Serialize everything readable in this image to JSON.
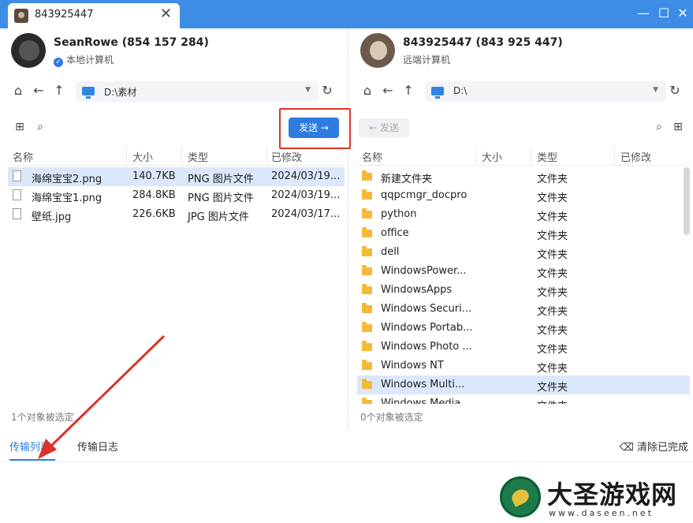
{
  "tab": {
    "title": "843925447",
    "close": "✕"
  },
  "window_controls": {
    "minimize": "—",
    "maximize": "☐",
    "close": "✕"
  },
  "local": {
    "user_name": "SeanRowe (854 157 284)",
    "user_sub": "本地计算机",
    "path": "D:\\素材",
    "send_label": "发送 →",
    "columns": [
      "名称",
      "大小",
      "类型",
      "已修改"
    ],
    "files": [
      {
        "name": "海绵宝宝2.png",
        "size": "140.7KB",
        "type": "PNG 图片文件",
        "modified": "2024/03/19...",
        "selected": true
      },
      {
        "name": "海绵宝宝1.png",
        "size": "284.8KB",
        "type": "PNG 图片文件",
        "modified": "2024/03/19...",
        "selected": false
      },
      {
        "name": "壁纸.jpg",
        "size": "226.6KB",
        "type": "JPG 图片文件",
        "modified": "2024/03/17...",
        "selected": false
      }
    ],
    "status": "1个对象被选定"
  },
  "remote": {
    "user_name": "843925447 (843 925 447)",
    "user_sub": "远端计算机",
    "path": "D:\\",
    "back_label": "← 发送",
    "columns": [
      "名称",
      "大小",
      "类型",
      "已修改"
    ],
    "files": [
      {
        "name": "新建文件夹",
        "type": "文件夹"
      },
      {
        "name": "qqpcmgr_docpro",
        "type": "文件夹"
      },
      {
        "name": "python",
        "type": "文件夹"
      },
      {
        "name": "office",
        "type": "文件夹"
      },
      {
        "name": "dell",
        "type": "文件夹"
      },
      {
        "name": "WindowsPower...",
        "type": "文件夹"
      },
      {
        "name": "WindowsApps",
        "type": "文件夹"
      },
      {
        "name": "Windows Securi...",
        "type": "文件夹"
      },
      {
        "name": "Windows Portab...",
        "type": "文件夹"
      },
      {
        "name": "Windows Photo ...",
        "type": "文件夹"
      },
      {
        "name": "Windows NT",
        "type": "文件夹"
      },
      {
        "name": "Windows Multi...",
        "type": "文件夹"
      },
      {
        "name": "Windows Media...",
        "type": "文件夹"
      }
    ],
    "status": "0个对象被选定"
  },
  "bottom_tabs": {
    "transfer_list": "传输列表",
    "transfer_log": "传输日志",
    "clear_done": "清除已完成"
  },
  "watermark": {
    "text": "大圣游戏网",
    "url": "www.daseen.net"
  },
  "colors": {
    "accent": "#2f7be0",
    "titlebar": "#3d8de6",
    "highlight": "#e0332b",
    "folder": "#f5b93a"
  }
}
